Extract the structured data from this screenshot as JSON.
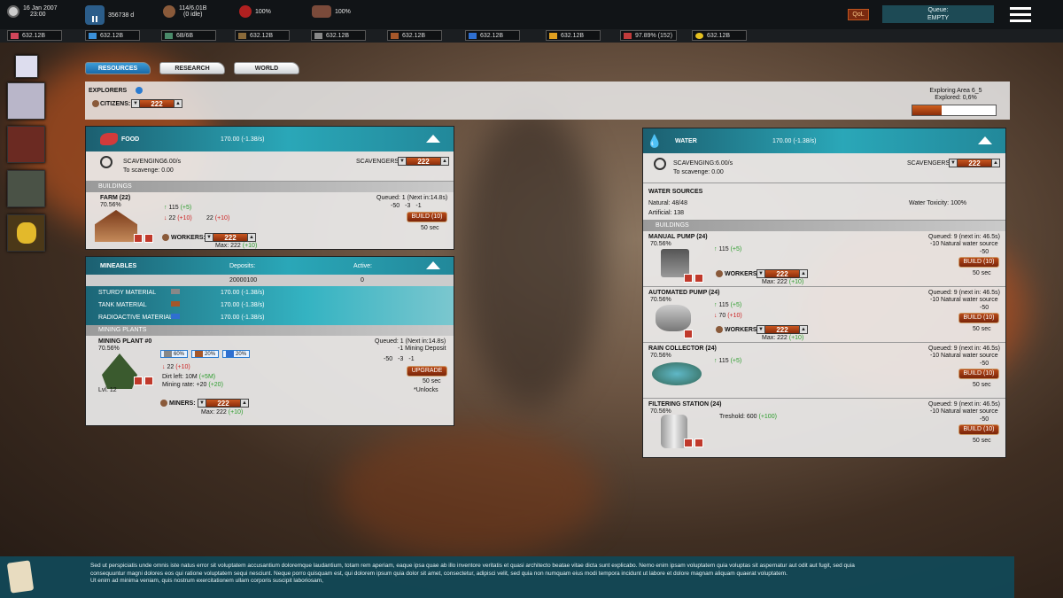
{
  "topbar": {
    "date": "16 Jan 2007",
    "time": "23:00",
    "days": "356738 d",
    "pop": "114/6.01B",
    "idle": "(0 idle)",
    "health": "100%",
    "meat": "100%",
    "qol": "QoL",
    "queue_label": "Queue:",
    "queue_value": "EMPTY"
  },
  "resources": [
    "632.12B",
    "632.12B",
    "6B/6B",
    "632.12B",
    "632.12B",
    "632.12B",
    "632.12B",
    "632.12B",
    "97.89% (152)",
    "632.12B"
  ],
  "tabs": [
    "RESOURCES",
    "RESEARCH",
    "WORLD"
  ],
  "explorers": {
    "title": "EXPLORERS",
    "citizens_label": "CITIZENS:",
    "citizens": "222",
    "area": "Exploring Area 6_5",
    "explored": "Explored: 0,6%",
    "progress": 0.6
  },
  "food": {
    "title": "FOOD",
    "rate": "170.00  (-1.38/s)",
    "scav_label": "SCAVENGING:",
    "scav_rate": "6.00/s",
    "to_scav": "To scavenge: 0.00",
    "scavengers_label": "SCAVENGERS:",
    "scavengers": "222",
    "buildings_label": "BUILDINGS",
    "farm": {
      "name": "FARM (22)",
      "pct": "70.56%",
      "prod1": "115",
      "prod1b": "(+5)",
      "cost1": "22",
      "cost1b": "(+10)",
      "cost2": "22",
      "cost2b": "(+10)",
      "queued": "Queued: 1 (Next in:14.8s)",
      "c1": "-50",
      "c2": "-3",
      "c3": "-1",
      "build": "BUILD (10)",
      "time": "50 sec",
      "workers_label": "WORKERS:",
      "workers": "222",
      "max": "Max: 222",
      "maxb": "(+10)"
    }
  },
  "mineables": {
    "title": "MINEABLES",
    "deposits_label": "Deposits:",
    "active_label": "Active:",
    "deposits": "20000100",
    "active": "0",
    "items": [
      {
        "name": "STURDY MATERIAL",
        "val": "170.00  (-1.38/s)"
      },
      {
        "name": "TANK MATERIAL",
        "val": "170.00  (-1.38/s)"
      },
      {
        "name": "RADIOACTIVE MATERIAL",
        "val": "170.00  (-1.38/s)"
      }
    ],
    "plants_label": "MINING PLANTS",
    "plant": {
      "name": "MINING PLANT #0",
      "pct": "70.56%",
      "p1": "60%",
      "p2": "20%",
      "p3": "20%",
      "cost": "22",
      "costb": "(+10)",
      "dirt": "Dirt left: 10M",
      "dirtb": "(+5M)",
      "rate": "Mining rate: +20",
      "rateb": "(+20)",
      "lvl": "Lvl. 12",
      "queued": "Queued: 1 (Next in:14.8s)",
      "deposit": "-1 Mining Deposit",
      "c1": "-50",
      "c2": "-3",
      "c3": "-1",
      "upgrade": "UPGRADE",
      "time": "50 sec",
      "unlocks": "*Unlocks",
      "miners_label": "MINERS:",
      "miners": "222",
      "max": "Max: 222",
      "maxb": "(+10)"
    }
  },
  "water": {
    "title": "WATER",
    "rate": "170.00  (-1.38/s)",
    "scav_label": "SCAVENGING:",
    "scav_rate": "6.00/s",
    "to_scav": "To scavenge: 0.00",
    "scavengers_label": "SCAVENGERS:",
    "scavengers": "222",
    "sources_label": "WATER SOURCES",
    "natural": "Natural: 48/48",
    "artificial": "Artificial: 138",
    "toxicity": "Water Toxicity: 100%",
    "buildings_label": "BUILDINGS",
    "buildings": [
      {
        "name": "MANUAL PUMP (24)",
        "pct": "70.56%",
        "line1": "115",
        "line1b": "(+5)",
        "line2": "",
        "line2b": "",
        "queued": "Queued: 9 (next in: 46.5s)",
        "source": "-10 Natural water source",
        "cost": "-50",
        "build": "BUILD (10)",
        "time": "50 sec",
        "workers_label": "WORKERS:",
        "workers": "222",
        "max": "Max: 222",
        "maxb": "(+10)"
      },
      {
        "name": "AUTOMATED PUMP (24)",
        "pct": "70.56%",
        "line1": "115",
        "line1b": "(+5)",
        "line2": "70",
        "line2b": "(+10)",
        "queued": "Queued: 9 (next in: 46.5s)",
        "source": "-10 Natural water source",
        "cost": "-50",
        "build": "BUILD (10)",
        "time": "50 sec",
        "workers_label": "WORKERS:",
        "workers": "222",
        "max": "Max: 222",
        "maxb": "(+10)"
      },
      {
        "name": "RAIN COLLECTOR (24)",
        "pct": "70.56%",
        "line1": "115",
        "line1b": "(+5)",
        "queued": "Queued: 9 (next in: 46.5s)",
        "source": "-10 Natural water source",
        "cost": "-50",
        "build": "BUILD (10)",
        "time": "50 sec"
      },
      {
        "name": "FILTERING STATION (24)",
        "pct": "70.56%",
        "tres": "Treshold: 600",
        "tresb": "(+100)",
        "queued": "Queued: 9 (next in: 46.5s)",
        "source": "-10 Natural water source",
        "cost": "-50",
        "build": "BUILD (10)",
        "time": "50 sec"
      }
    ]
  },
  "message": {
    "l1": "Sed ut perspiciatis unde omnis iste natus error sit voluptatem accusantium doloremque laudantium, totam rem aperiam, eaque ipsa quae ab illo inventore veritatis et quasi architecto beatae vitae dicta sunt explicabo. Nemo enim ipsam voluptatem quia voluptas sit aspernatur aut odit aut fugit, sed quia",
    "l2": "consequuntur magni dolores eos qui ratione voluptatem sequi nesciunt. Neque porro quisquam est, qui dolorem ipsum quia dolor sit amet, consectetur, adipisci velit, sed quia non numquam eius modi tempora incidunt ut labore et dolore magnam aliquam quaerat voluptatem.",
    "l3": "Ut enim ad minima veniam, quis nostrum exercitationem ullam corporis suscipit laboriosam,"
  },
  "colors": {
    "accent": "#2aa7b8",
    "build": "#b84a18",
    "tab_active": "#2a86c8"
  }
}
